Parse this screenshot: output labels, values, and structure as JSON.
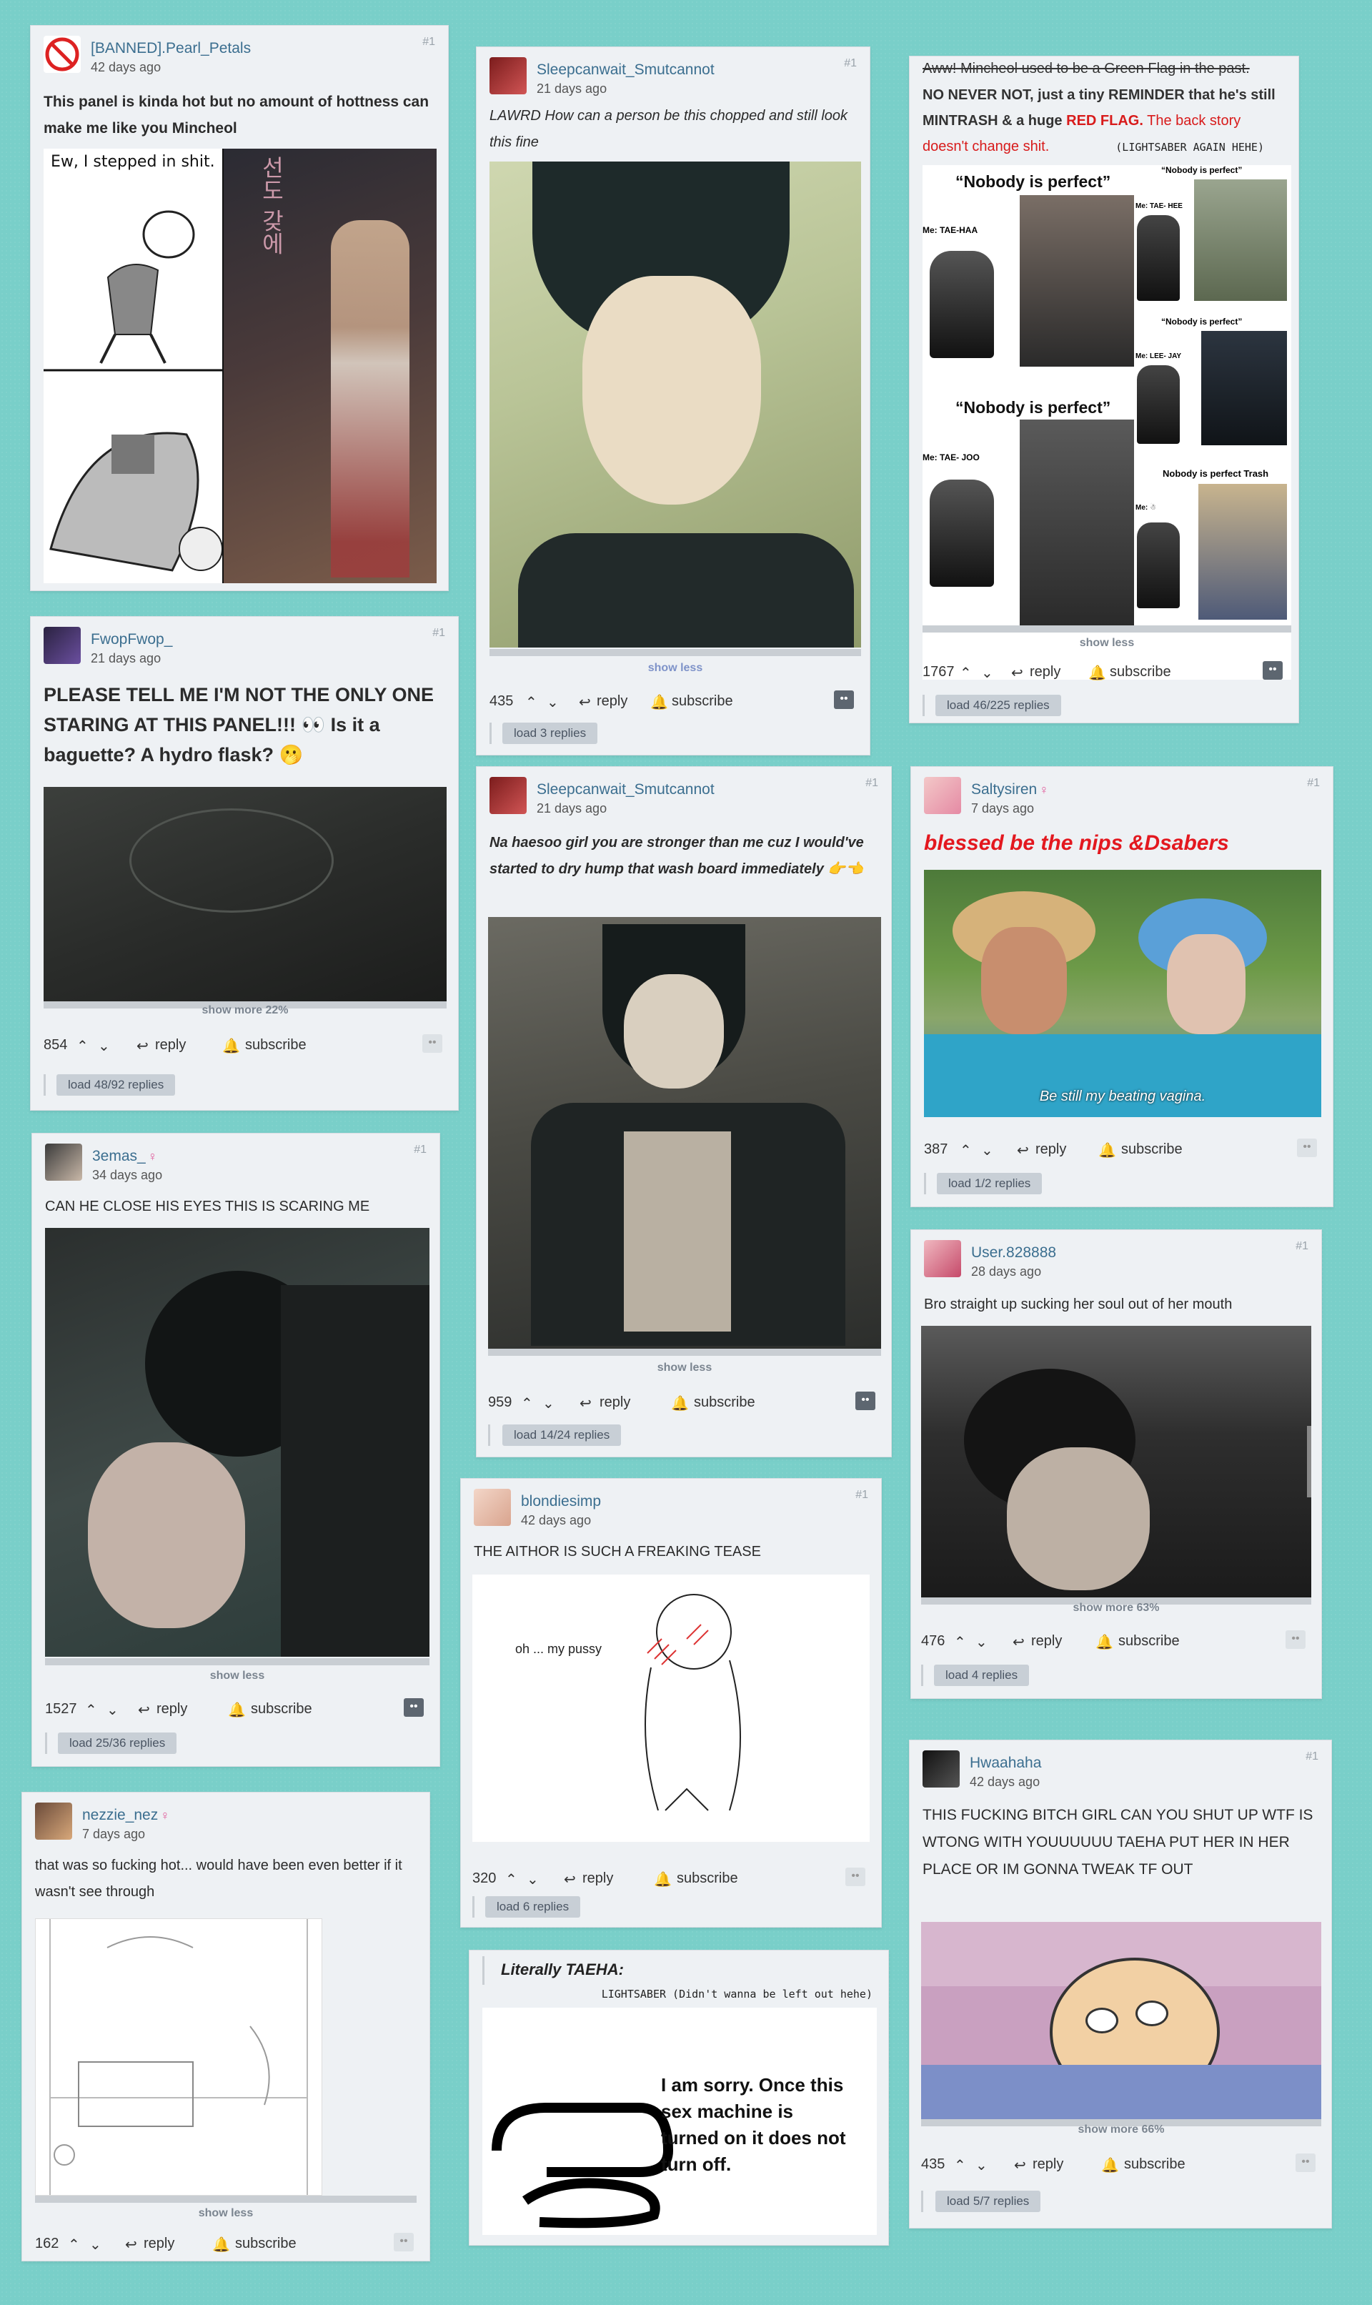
{
  "ui": {
    "reply": "reply",
    "subscribe": "subscribe",
    "dots": "••"
  },
  "cards": {
    "c1": {
      "user": "[BANNED].Pearl_Petals",
      "ago": "42 days ago",
      "num": "#1",
      "text": "This panel is kinda hot but no amount of hottness can make me like you Mincheol",
      "img_caption": "Ew, I stepped in shit.",
      "vertical_text": "선도 갖에"
    },
    "c2": {
      "user": "Sleepcanwait_Smutcannot",
      "ago": "21 days ago",
      "num": "#1",
      "text": "LAWRD How can a person be this chopped and still look this fine",
      "more": "show less",
      "votes": "435",
      "load": "load 3 replies"
    },
    "c3": {
      "strike": "Aww! Mincheol used to be a Green Flag in the past.",
      "line1": "NO NEVER NOT, just a tiny REMINDER that he's still MINTRASH & a huge ",
      "red_flag": "RED FLAG.",
      "line1b": " The back story doesn't change shit.",
      "credit": "(LIGHTSABER AGAIN HEHE)",
      "meme": {
        "np": "“Nobody is perfect”",
        "np_small": "“Nobody is perfect”",
        "np_trash": "Nobody is perfect Trash",
        "me1": "Me:  TAE-HAA",
        "me2": "Me:  TAE- JOO",
        "me3": "Me: TAE- HEE",
        "me4": "Me: LEE- JAY",
        "me5": "Me: ☃"
      },
      "more": "show less",
      "votes": "1767",
      "load": "load 46/225 replies"
    },
    "c4": {
      "user": "FwopFwop_",
      "ago": "21 days ago",
      "num": "#1",
      "text": "PLEASE TELL ME I'M NOT THE ONLY ONE STARING AT THIS PANEL!!! 👀 Is it a baguette? A hydro flask? 🫢",
      "more": "show more 22%",
      "votes": "854",
      "load": "load 48/92 replies"
    },
    "c5": {
      "user": "Sleepcanwait_Smutcannot",
      "ago": "21 days ago",
      "num": "#1",
      "text": "Na haesoo girl you are stronger than me cuz I would've started to dry hump that wash board immediately 👉👈",
      "more": "show less",
      "votes": "959",
      "load": "load 14/24 replies"
    },
    "c6": {
      "user": "Saltysiren",
      "ago": "7 days ago",
      "num": "#1",
      "text": "blessed be the nips &Dsabers",
      "img_caption": "Be still my beating vagina.",
      "votes": "387",
      "load": "load 1/2 replies"
    },
    "c7": {
      "user": "3emas_",
      "ago": "34 days ago",
      "num": "#1",
      "text": "CAN HE CLOSE HIS EYES THIS IS SCARING ME",
      "more": "show less",
      "votes": "1527",
      "load": "load 25/36 replies"
    },
    "c8": {
      "user": "User.828888",
      "ago": "28 days ago",
      "num": "#1",
      "text": "Bro straight up sucking her soul out of her mouth",
      "more": "show more 63%",
      "votes": "476",
      "load": "load 4 replies"
    },
    "c9": {
      "user": "blondiesimp",
      "ago": "42 days ago",
      "num": "#1",
      "text": "THE AITHOR IS SUCH A FREAKING TEASE",
      "img_caption": "oh ... my pussy",
      "votes": "320",
      "load": "load 6 replies"
    },
    "c10": {
      "user": "nezzie_nez",
      "ago": "7 days ago",
      "num": "#1",
      "text": "that was so fucking hot... would have been even better if it wasn't see through",
      "more": "show less",
      "votes": "162"
    },
    "c11": {
      "title": "Literally TAEHA:",
      "credit": "LIGHTSABER (Didn't wanna be left out hehe)",
      "meme_text": "I am sorry. Once this sex machine is turned on it does not turn off."
    },
    "c12": {
      "user": "Hwaahaha",
      "ago": "42 days ago",
      "num": "#1",
      "text": "THIS FUCKING BITCH GIRL CAN YOU SHUT UP WTF IS WTONG WITH YOUUUUUU TAEHA PUT HER IN HER PLACE OR IM GONNA TWEAK TF OUT",
      "more": "show more 66%",
      "votes": "435",
      "load": "load 5/7 replies"
    }
  }
}
